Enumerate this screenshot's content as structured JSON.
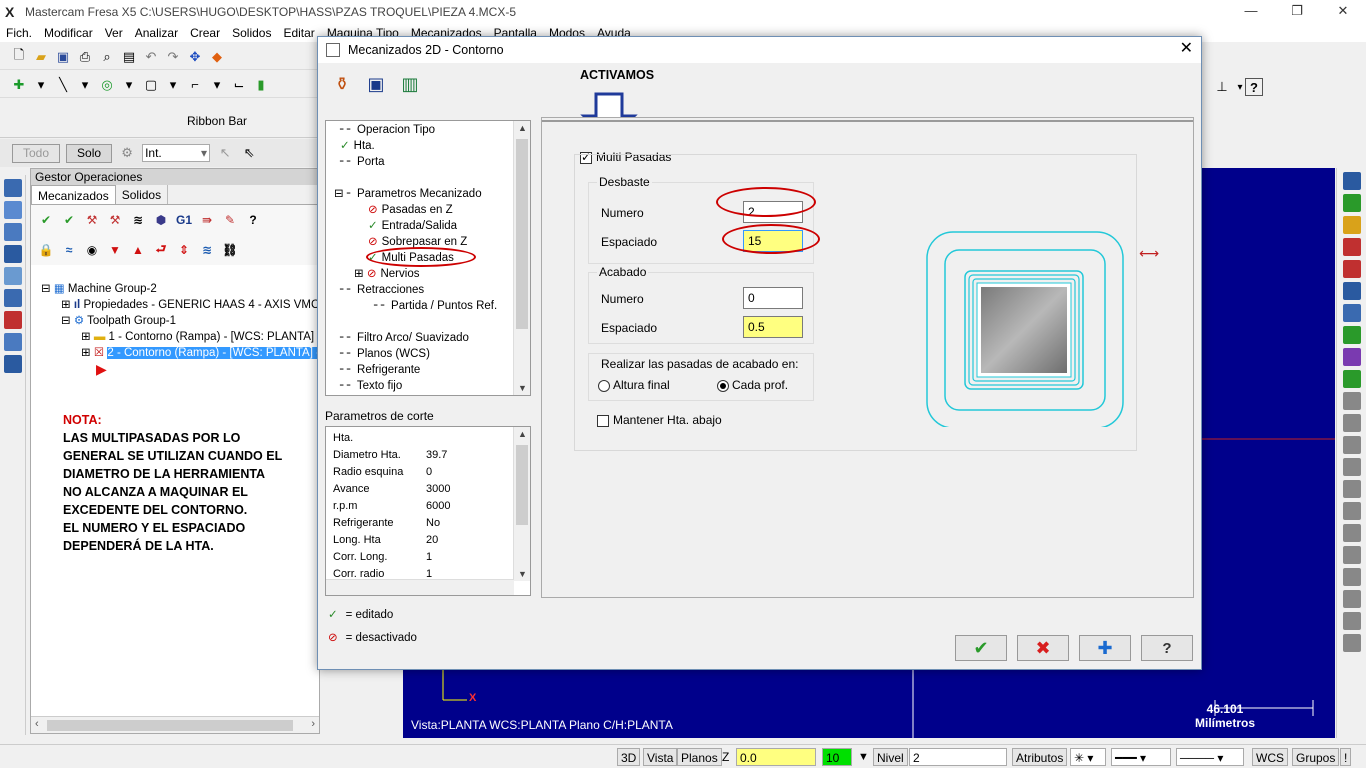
{
  "window": {
    "title": "Mastercam Fresa X5  C:\\USERS\\HUGO\\DESKTOP\\HASS\\PZAS TROQUEL\\PIEZA 4.MCX-5",
    "minimize": "—",
    "restore": "❐",
    "close": "✕"
  },
  "menu": [
    "Fich.",
    "Modificar",
    "Ver",
    "Analizar",
    "Crear",
    "Solidos",
    "Editar",
    "Maquina Tipo",
    "Mecanizados",
    "Pantalla",
    "Modos",
    "Ayuda"
  ],
  "ribbon": {
    "label": "Ribbon Bar"
  },
  "selection_bar": {
    "todo": "Todo",
    "solo": "Solo",
    "mode": "Int."
  },
  "gestor": {
    "header": "Gestor Operaciones",
    "tabs": [
      "Mecanizados",
      "Solidos"
    ],
    "tree": [
      "Machine Group-2",
      "Propiedades - GENERIC HAAS 4 - AXIS VMC",
      "Toolpath Group-1",
      "1 - Contorno  (Rampa) - [WCS: PLANTA] -",
      "2 - Contorno  (Rampa) - [WCS: PLANTA] -"
    ],
    "note_title": "NOTA:",
    "note_lines": [
      "LAS MULTIPASADAS POR LO",
      "GENERAL SE UTILIZAN CUANDO EL",
      "DIAMETRO DE LA HERRAMIENTA",
      "NO ALCANZA A MAQUINAR EL",
      "EXCEDENTE DEL CONTORNO.",
      "EL NUMERO Y EL ESPACIADO",
      "DEPENDERÁ DE LA HTA."
    ]
  },
  "dialog": {
    "title": "Mecanizados 2D - Contorno",
    "close": "✕",
    "annotation": "ACTIVAMOS",
    "param_tree": [
      "Operacion Tipo",
      "Hta.",
      "Porta",
      "Parametros Mecanizado",
      "Pasadas en Z",
      "Entrada/Salida",
      "Sobrepasar en Z",
      "Multi Pasadas",
      "Nervios",
      "Retracciones",
      "Partida / Puntos Ref.",
      "Filtro Arco/ Suavizado",
      "Planos (WCS)",
      "Refrigerante",
      "Texto fijo"
    ],
    "cut_params_label": "Parametros de corte",
    "cut_params": [
      {
        "k": "Hta.",
        "v": ""
      },
      {
        "k": "Diametro Hta.",
        "v": "39.7"
      },
      {
        "k": "Radio esquina",
        "v": "0"
      },
      {
        "k": "Avance",
        "v": "3000"
      },
      {
        "k": "r.p.m",
        "v": "6000"
      },
      {
        "k": "Refrigerante",
        "v": "No"
      },
      {
        "k": "Long. Hta",
        "v": "20"
      },
      {
        "k": "Corr. Long.",
        "v": "1"
      },
      {
        "k": "Corr. radio",
        "v": "1"
      }
    ],
    "legend_edited": "= editado",
    "legend_disabled": "= desactivado",
    "multi_pasadas": "Multi Pasadas",
    "desbaste": {
      "label": "Desbaste",
      "numero_label": "Numero",
      "numero": "2",
      "espaciado_label": "Espaciado",
      "espaciado": "15"
    },
    "acabado": {
      "label": "Acabado",
      "numero_label": "Numero",
      "numero": "0",
      "espaciado_label": "Espaciado",
      "espaciado": "0.5"
    },
    "finish_passes": {
      "label": "Realizar las pasadas de acabado en:",
      "opt1": "Altura final",
      "opt2": "Cada prof.",
      "selected": "Cada prof."
    },
    "keep_tool_down": "Mantener Hta. abajo"
  },
  "canvas": {
    "status": "Vista:PLANTA   WCS:PLANTA   Plano C/H:PLANTA",
    "scale_value": "46.101",
    "scale_unit": "Milímetros",
    "axis_x": "X"
  },
  "statusbar": {
    "b3d": "3D",
    "vista": "Vista",
    "planos": "Planos",
    "z": "Z",
    "z_value": "0.0",
    "color_value": "10",
    "nivel": "Nivel",
    "nivel_value": "2",
    "atributos": "Atributos",
    "wcs": "WCS",
    "grupos": "Grupos",
    "excl": "!"
  },
  "colors": {
    "canvas_bg": "#00008b",
    "selection": "#3399ff",
    "highlight_input": "#ffff80",
    "annotation_red": "#c00000",
    "arrow_blue": "#1f3a9a"
  }
}
